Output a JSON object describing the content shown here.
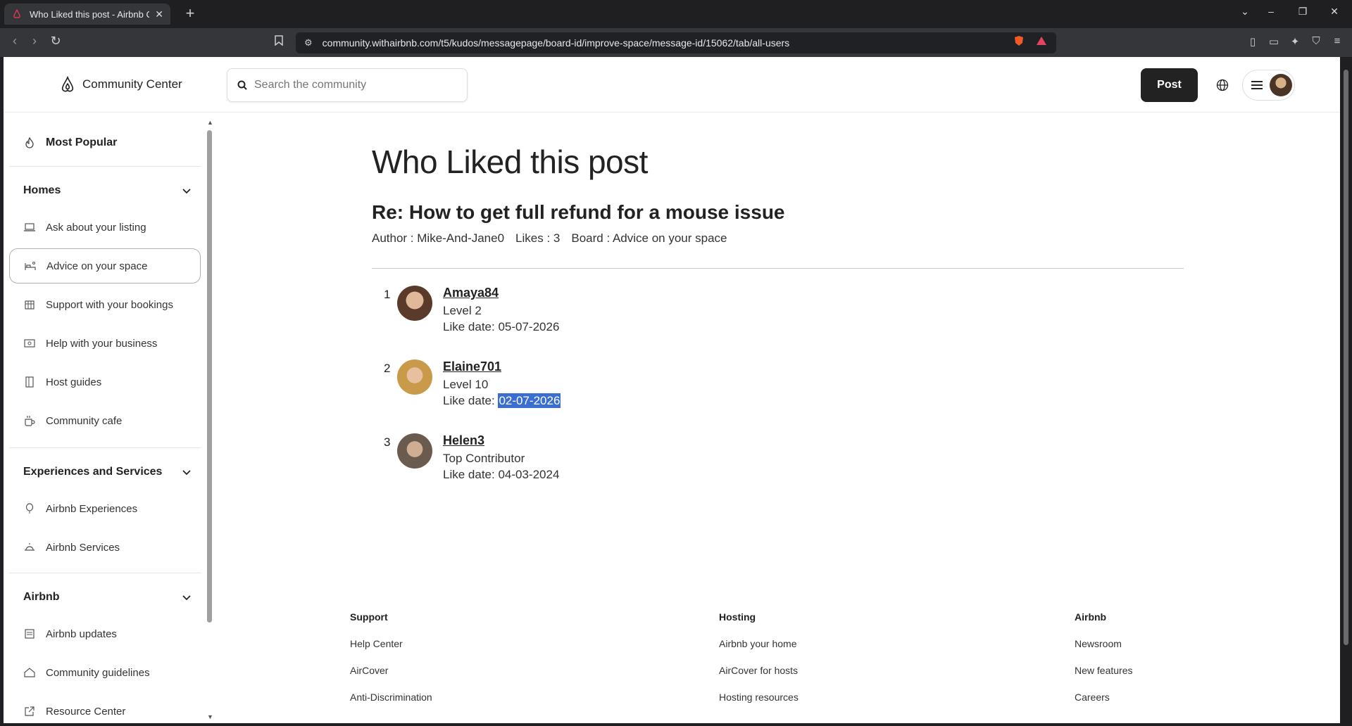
{
  "browser": {
    "tab_title": "Who Liked this post - Airbnb Co",
    "url": "community.withairbnb.com/t5/kudos/messagepage/board-id/improve-space/message-id/15062/tab/all-users"
  },
  "header": {
    "brand": "Community Center",
    "search_placeholder": "Search the community",
    "post_button": "Post"
  },
  "sidebar": {
    "top_item": "Most Popular",
    "sections": [
      {
        "title": "Homes",
        "items": [
          {
            "label": "Ask about your listing",
            "icon": "laptop-icon"
          },
          {
            "label": "Advice on your space",
            "icon": "bed-icon"
          },
          {
            "label": "Support with your bookings",
            "icon": "calendar-icon"
          },
          {
            "label": "Help with your business",
            "icon": "cash-icon"
          },
          {
            "label": "Host guides",
            "icon": "book-icon"
          },
          {
            "label": "Community cafe",
            "icon": "coffee-icon"
          }
        ]
      },
      {
        "title": "Experiences and Services",
        "items": [
          {
            "label": "Airbnb Experiences",
            "icon": "balloon-icon"
          },
          {
            "label": "Airbnb Services",
            "icon": "bell-icon"
          }
        ]
      },
      {
        "title": "Airbnb",
        "items": [
          {
            "label": "Airbnb updates",
            "icon": "news-icon"
          },
          {
            "label": "Community guidelines",
            "icon": "house-heart-icon"
          },
          {
            "label": "Resource Center",
            "icon": "external-link-icon"
          }
        ]
      }
    ]
  },
  "main": {
    "title": "Who Liked this post",
    "post_title": "Re: How to get full refund for a mouse issue",
    "meta": {
      "author": "Author : Mike-And-Jane0",
      "likes": "Likes : 3",
      "board": "Board : Advice on your space"
    },
    "likers": [
      {
        "num": "1",
        "username": "Amaya84",
        "rank": "Level 2",
        "date_label": "Like date: ",
        "date": "05-07-2026"
      },
      {
        "num": "2",
        "username": "Elaine701",
        "rank": "Level 10",
        "date_label": "Like date: ",
        "date": "02-07-2026"
      },
      {
        "num": "3",
        "username": "Helen3",
        "rank": "Top Contributor",
        "date_label": "Like date: ",
        "date": "04-03-2024"
      }
    ]
  },
  "footer": {
    "columns": [
      {
        "heading": "Support",
        "links": [
          "Help Center",
          "AirCover",
          "Anti-Discrimination"
        ]
      },
      {
        "heading": "Hosting",
        "links": [
          "Airbnb your home",
          "AirCover for hosts",
          "Hosting resources"
        ]
      },
      {
        "heading": "Airbnb",
        "links": [
          "Newsroom",
          "New features",
          "Careers"
        ]
      }
    ]
  },
  "colors": {
    "accent": "#222222",
    "selection": "#3a6fd1",
    "brand_red": "#ff385c"
  }
}
